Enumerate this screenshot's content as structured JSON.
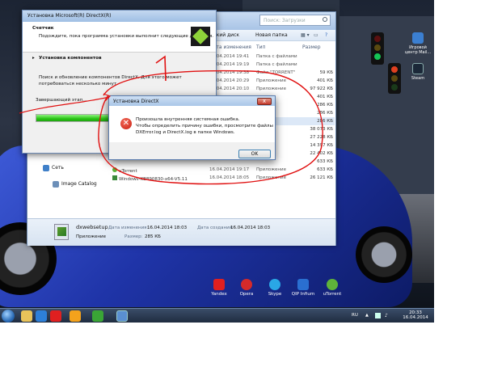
{
  "installer": {
    "title": "Установка Microsoft(R) DirectX(R)",
    "header_title": "Счетчик",
    "header_subtitle": "Подождите, пока программа установки выполнит следующие действия.",
    "step_label": "Установка компонентов",
    "detail_line1": "Поиск и обновление компонентов DirectX. Для этого может",
    "detail_line2": "потребоваться несколько минут.",
    "finishing_label": "Завершающий этап...",
    "progress_fraction": 0.75
  },
  "explorer": {
    "search_placeholder": "Поиск: Загрузки",
    "toolbar": {
      "burn": "Записать на оптический диск",
      "new_folder": "Новая папка"
    },
    "columns": {
      "date": "Дата изменения",
      "type": "Тип",
      "size": "Размер"
    },
    "rows": [
      {
        "date": "16.04.2014 19:41",
        "type": "Папка с файлами",
        "size": ""
      },
      {
        "date": "16.04.2014 19:19",
        "type": "Папка с файлами",
        "size": ""
      },
      {
        "date": "16.04.2014 19:38",
        "type": "Файл \"TORRENT\"",
        "size": "59 КБ"
      },
      {
        "date": "16.04.2014 20:29",
        "type": "Приложение",
        "size": "401 КБ"
      },
      {
        "date": "16.04.2014 20:10",
        "type": "Приложение",
        "size": "97 922 КБ"
      },
      {
        "date": "",
        "type": "",
        "size": "401 КБ"
      },
      {
        "date": "",
        "type": "",
        "size": "286 КБ"
      },
      {
        "date": "",
        "type": "",
        "size": "286 КБ"
      },
      {
        "date": "",
        "type": "",
        "size": "286 КБ"
      },
      {
        "date": "",
        "type": "",
        "size": "38 073 КБ"
      },
      {
        "date": "",
        "type": "",
        "size": "27 228 КБ"
      },
      {
        "date": "",
        "type": "",
        "size": "14 397 КБ"
      },
      {
        "date": "",
        "type": "",
        "size": "22 402 КБ"
      },
      {
        "date": "",
        "type": "",
        "size": "633 КБ"
      },
      {
        "date": "16.04.2014 19:17",
        "type": "Приложение",
        "size": "633 КБ"
      },
      {
        "date": "16.04.2014 18:05",
        "type": "Приложение",
        "size": "26 121 КБ"
      }
    ],
    "row_names": {
      "utorrent": "uTorrent",
      "windows_kb": "Windows-KB890830-x64-V5.11"
    },
    "nav": {
      "network": "Сеть",
      "image_catalog": "Image Catalog"
    },
    "status": {
      "filename": "dxwebsetup",
      "modified_label": "Дата изменения:",
      "modified_value": "16.04.2014 18:03",
      "created_label": "Дата создания:",
      "created_value": "16.04.2014 18:03",
      "type_value": "Приложение",
      "size_label": "Размер:",
      "size_value": "285 КБ"
    }
  },
  "dialog": {
    "title": "Установка DirectX",
    "line1": "Произошла внутренняя системная ошибка.",
    "line2": "Чтобы определить причину ошибки, просмотрите файлы",
    "line3": "DXError.log и DirectX.log в папке Windows.",
    "ok_label": "OK",
    "close_label": "x"
  },
  "annotation": {
    "number": "1",
    "color": "#e01010"
  },
  "desktop": {
    "right_icons": [
      {
        "line1": "Игровой",
        "line2": "центр Mail...",
        "color": "#3b7fd1"
      },
      {
        "line1": "Steam",
        "line2": "",
        "color": "#1b2838"
      }
    ],
    "shortcuts": [
      {
        "label": "Yandex",
        "color": "#e02020"
      },
      {
        "label": "Opera",
        "color": "#d42a2a"
      },
      {
        "label": "Skype",
        "color": "#2aa7e6"
      },
      {
        "label": "QIP Infium",
        "color": "#2a6fd1"
      },
      {
        "label": "uTorrent",
        "color": "#5fb33a"
      }
    ]
  },
  "taskbar": {
    "lang": "RU",
    "time": "20:33",
    "date": "16.04.2014",
    "apps": [
      {
        "name": "explorer",
        "color": "#e8c35a"
      },
      {
        "name": "media-player",
        "color": "#2d7fd8"
      },
      {
        "name": "yandex",
        "color": "#e02020"
      },
      {
        "name": "mail-agent",
        "color": "#f4a21c"
      },
      {
        "name": "app-green",
        "color": "#3aa536"
      },
      {
        "name": "dxsetup",
        "color": "#5a8fd1"
      }
    ]
  }
}
